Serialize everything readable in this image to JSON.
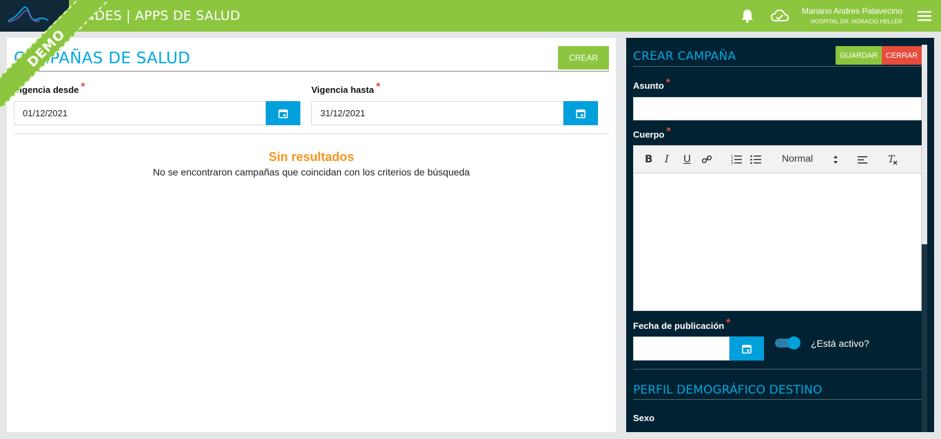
{
  "header": {
    "app_title": "ANDES | APPS DE SALUD",
    "user_name": "Mariano Andres Palavecino",
    "user_hospital": "HOSPITAL DR. HORACIO HELLER",
    "ribbon": "DEMO"
  },
  "campaigns": {
    "title": "CAMPAÑAS DE SALUD",
    "create_label": "CREAR",
    "from_label": "Vigencia desde",
    "from_value": "01/12/2021",
    "to_label": "Vigencia hasta",
    "to_value": "31/12/2021",
    "empty_title": "Sin resultados",
    "empty_text": "No se encontraron campañas que coincidan con los criterios de búsqueda"
  },
  "form": {
    "title": "CREAR CAMPAÑA",
    "save_label": "GUARDAR",
    "close_label": "CERRAR",
    "subject_label": "Asunto",
    "subject_value": "",
    "body_label": "Cuerpo",
    "format_select": "Normal",
    "pub_date_label": "Fecha de publicación",
    "pub_date_value": "",
    "active_label": "¿Está activo?",
    "active": true,
    "demographic_title": "PERFIL DEMOGRÁFICO DESTINO",
    "sex_label": "Sexo"
  },
  "colors": {
    "brand_green": "#8cc63f",
    "accent_blue": "#00a0dc",
    "danger_red": "#e74c3c",
    "warning_orange": "#f7941d",
    "panel_dark": "#002232"
  }
}
